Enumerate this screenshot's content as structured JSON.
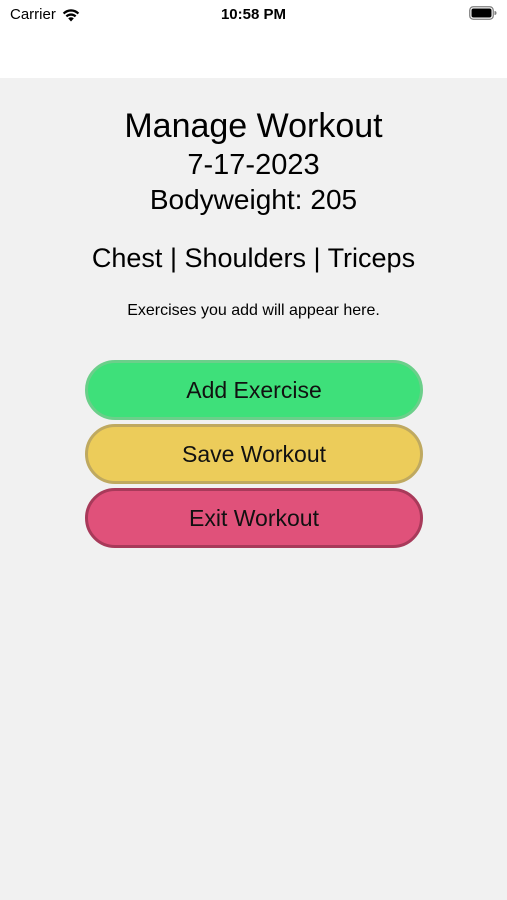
{
  "status_bar": {
    "carrier": "Carrier",
    "time": "10:58 PM"
  },
  "screen": {
    "title": "Manage Workout",
    "date": "7-17-2023",
    "bodyweight_label": "Bodyweight:",
    "bodyweight_value": "205",
    "muscle_groups": "Chest | Shoulders | Triceps",
    "empty_message": "Exercises you add will appear here."
  },
  "buttons": {
    "add_exercise": "Add Exercise",
    "save_workout": "Save Workout",
    "exit_workout": "Exit Workout"
  },
  "colors": {
    "add": "#3ee07a",
    "save": "#eccc5a",
    "exit": "#e0517a",
    "background": "#f1f1f1"
  }
}
